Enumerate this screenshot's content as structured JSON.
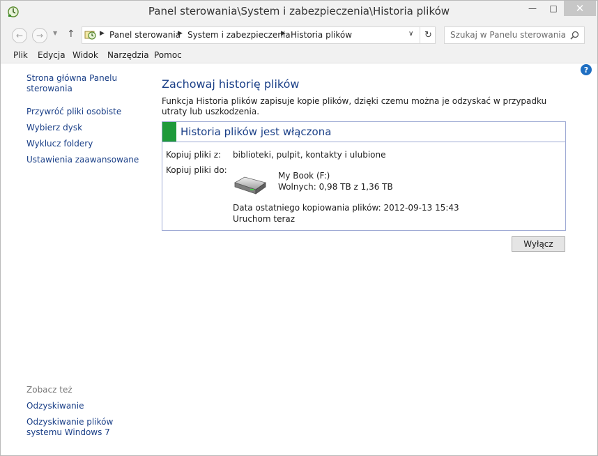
{
  "window": {
    "title": "Panel sterowania\\System i zabezpieczenia\\Historia plików",
    "icons": {
      "app": "file-history-icon",
      "minimize": "minimize-icon",
      "maximize": "maximize-icon",
      "close": "close-icon"
    }
  },
  "navigation": {
    "breadcrumbs": [
      "Panel sterowania",
      "System i zabezpieczenia",
      "Historia plików"
    ],
    "search_placeholder": "Szukaj w Panelu sterowania"
  },
  "menu": [
    "Plik",
    "Edycja",
    "Widok",
    "Narzędzia",
    "Pomoc"
  ],
  "sidebar": {
    "links": [
      "Strona główna Panelu sterowania",
      "Przywróć pliki osobiste",
      "Wybierz dysk",
      "Wyklucz foldery",
      "Ustawienia zaawansowane"
    ],
    "see_also_label": "Zobacz też",
    "see_also": [
      "Odzyskiwanie",
      "Odzyskiwanie plików systemu Windows 7"
    ]
  },
  "main": {
    "heading": "Zachowaj historię plików",
    "description": "Funkcja Historia plików zapisuje kopie plików, dzięki czemu można je odzyskać w przypadku utraty lub uszkodzenia.",
    "status": {
      "title": "Historia plików jest włączona",
      "status_color": "#1e9a3a",
      "copy_files_label": "Kopiuj pliki z:",
      "copy_files_value": "biblioteki, pulpit, kontakty i ulubione",
      "copy_to_label": "Kopiuj pliki do:",
      "drive_name": "My Book (F:)",
      "drive_free": "Wolnych: 0,98 TB z 1,36 TB",
      "last_copy": "Data ostatniego kopiowania plików: 2012-09-13 15:43",
      "run_now": "Uruchom teraz"
    },
    "turn_off_button": "Wyłącz"
  }
}
